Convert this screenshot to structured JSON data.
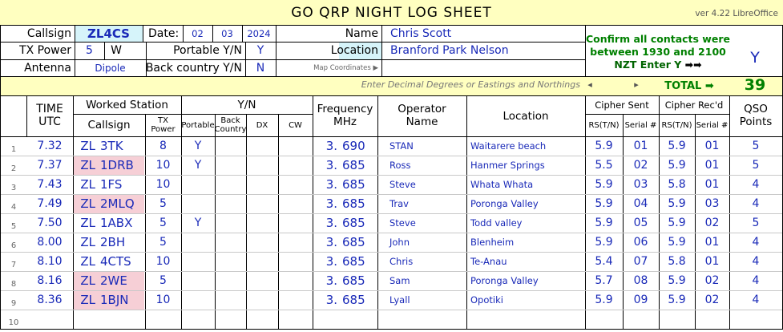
{
  "header": {
    "title": "GO  QRP  NIGHT  LOG  SHEET",
    "version": "ver 4.22 LibreOffice"
  },
  "station": {
    "callsign_label": "Callsign",
    "callsign": "ZL4CS",
    "date_label": "Date:",
    "date_day": "02",
    "date_month": "03",
    "date_year": "2024",
    "name_label": "Name",
    "name": "Chris Scott",
    "tx_power_label": "TX Power",
    "tx_power": "5",
    "tx_unit": "W",
    "portable_label": "Portable Y/N",
    "portable": "Y",
    "location_label": "Location",
    "location": "Branford Park Nelson",
    "antenna_label": "Antenna",
    "antenna": "Dipole",
    "back_country_label": "Back country Y/N",
    "back_country": "N",
    "map_coords_label": "Map Coordinates ▶",
    "coords_hint": "Enter  Decimal Degrees or Eastings and Northings",
    "coords_arrow_left": "◂",
    "coords_arrow_right": "▸"
  },
  "confirm": {
    "line1": "Confirm all contacts were",
    "line2": "between 1930 and 2100",
    "line3": "NZT    Enter  Y",
    "arrows": "➡➡",
    "value": "Y"
  },
  "total": {
    "label": "TOTAL ➡",
    "value": "39"
  },
  "columns": {
    "time": "TIME",
    "utc": "UTC",
    "worked_station": "Worked Station",
    "callsign": "Callsign",
    "tx_power": "TX Power",
    "yn": "Y/N",
    "portable": "Portable",
    "back_country": "Back Country",
    "dx": "DX",
    "cw": "CW",
    "frequency": "Frequency",
    "mhz": "MHz",
    "operator": "Operator",
    "operator_name": "Name",
    "location": "Location",
    "cipher_sent": "Cipher Sent",
    "cipher_recd": "Cipher Rec'd",
    "rs": "RS(T/N)",
    "serial": "Serial #",
    "qso": "QSO",
    "points": "Points"
  },
  "rows": [
    {
      "n": "1",
      "time": "7.32",
      "prefix": "ZL",
      "suffix": "3TK",
      "pink": false,
      "power": "8",
      "portable": "Y",
      "freq_a": "3.",
      "freq_b": "690",
      "op": "STAN",
      "loc": "Waitarere beach",
      "rs_s": "5.9",
      "ser_s": "01",
      "rs_r": "5.9",
      "ser_r": "01",
      "pts": "5"
    },
    {
      "n": "2",
      "time": "7.37",
      "prefix": "ZL",
      "suffix": "1DRB",
      "pink": true,
      "power": "10",
      "portable": "Y",
      "freq_a": "3.",
      "freq_b": "685",
      "op": "Ross",
      "loc": "Hanmer Springs",
      "rs_s": "5.5",
      "ser_s": "02",
      "rs_r": "5.9",
      "ser_r": "01",
      "pts": "5"
    },
    {
      "n": "3",
      "time": "7.43",
      "prefix": "ZL",
      "suffix": "1FS",
      "pink": false,
      "power": "10",
      "portable": "",
      "freq_a": "3.",
      "freq_b": "685",
      "op": "Steve",
      "loc": "Whata Whata",
      "rs_s": "5.9",
      "ser_s": "03",
      "rs_r": "5.8",
      "ser_r": "01",
      "pts": "4"
    },
    {
      "n": "4",
      "time": "7.49",
      "prefix": "ZL",
      "suffix": "2MLQ",
      "pink": true,
      "power": "5",
      "portable": "",
      "freq_a": "3.",
      "freq_b": "685",
      "op": "Trav",
      "loc": "Poronga Valley",
      "rs_s": "5.9",
      "ser_s": "04",
      "rs_r": "5.9",
      "ser_r": "03",
      "pts": "4"
    },
    {
      "n": "5",
      "time": "7.50",
      "prefix": "ZL",
      "suffix": "1ABX",
      "pink": false,
      "power": "5",
      "portable": "Y",
      "freq_a": "3.",
      "freq_b": "685",
      "op": "Steve",
      "loc": "Todd valley",
      "rs_s": "5.9",
      "ser_s": "05",
      "rs_r": "5.9",
      "ser_r": "02",
      "pts": "5"
    },
    {
      "n": "6",
      "time": "8.00",
      "prefix": "ZL",
      "suffix": "2BH",
      "pink": false,
      "power": "5",
      "portable": "",
      "freq_a": "3.",
      "freq_b": "685",
      "op": "John",
      "loc": "Blenheim",
      "rs_s": "5.9",
      "ser_s": "06",
      "rs_r": "5.9",
      "ser_r": "01",
      "pts": "4"
    },
    {
      "n": "7",
      "time": "8.10",
      "prefix": "ZL",
      "suffix": "4CTS",
      "pink": false,
      "power": "10",
      "portable": "",
      "freq_a": "3.",
      "freq_b": "685",
      "op": "Chris",
      "loc": "Te-Anau",
      "rs_s": "5.4",
      "ser_s": "07",
      "rs_r": "5.8",
      "ser_r": "01",
      "pts": "4"
    },
    {
      "n": "8",
      "time": "8.16",
      "prefix": "ZL",
      "suffix": "2WE",
      "pink": true,
      "power": "5",
      "portable": "",
      "freq_a": "3.",
      "freq_b": "685",
      "op": "Sam",
      "loc": "Poronga Valley",
      "rs_s": "5.7",
      "ser_s": "08",
      "rs_r": "5.9",
      "ser_r": "02",
      "pts": "4"
    },
    {
      "n": "9",
      "time": "8.36",
      "prefix": "ZL",
      "suffix": "1BJN",
      "pink": true,
      "power": "10",
      "portable": "",
      "freq_a": "3.",
      "freq_b": "685",
      "op": "Lyall",
      "loc": "Opotiki",
      "rs_s": "5.9",
      "ser_s": "09",
      "rs_r": "5.9",
      "ser_r": "02",
      "pts": "4"
    },
    {
      "n": "10",
      "time": "",
      "prefix": "",
      "suffix": "",
      "pink": false,
      "power": "",
      "portable": "",
      "freq_a": "",
      "freq_b": "",
      "op": "",
      "loc": "",
      "rs_s": "",
      "ser_s": "",
      "rs_r": "",
      "ser_r": "",
      "pts": ""
    }
  ],
  "colors": {
    "title_bg": "#ffffc0",
    "highlight_pink": "#f6cfd6",
    "entry_blue": "#1a2ab8",
    "confirm_green": "#008000"
  }
}
